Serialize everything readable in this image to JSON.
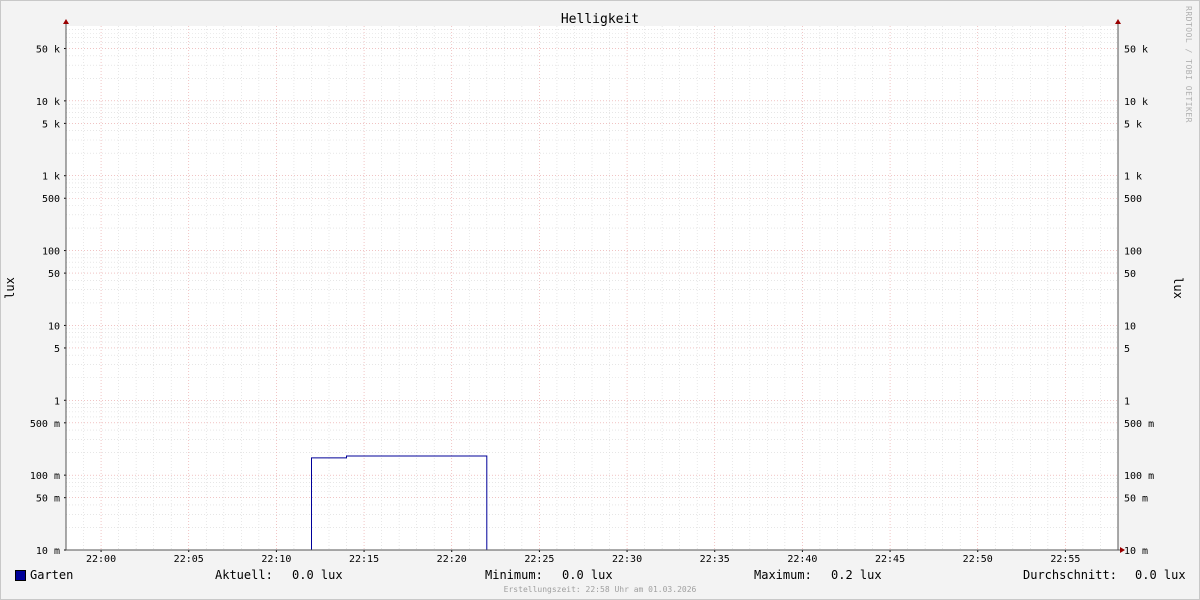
{
  "chart_data": {
    "type": "line",
    "title": "Helligkeit",
    "ylabel": "lux",
    "y_scale": "log",
    "ylim": [
      0.01,
      100000
    ],
    "y_ticks": [
      {
        "value": 0.01,
        "label": "10 m"
      },
      {
        "value": 0.05,
        "label": "50 m"
      },
      {
        "value": 0.1,
        "label": "100 m"
      },
      {
        "value": 0.5,
        "label": "500 m"
      },
      {
        "value": 1,
        "label": "1"
      },
      {
        "value": 5,
        "label": "5"
      },
      {
        "value": 10,
        "label": "10"
      },
      {
        "value": 50,
        "label": "50"
      },
      {
        "value": 100,
        "label": "100"
      },
      {
        "value": 500,
        "label": "500"
      },
      {
        "value": 1000,
        "label": "1 k"
      },
      {
        "value": 5000,
        "label": "5 k"
      },
      {
        "value": 10000,
        "label": "10 k"
      },
      {
        "value": 50000,
        "label": "50 k"
      }
    ],
    "x_ticks": [
      "22:00",
      "22:05",
      "22:10",
      "22:15",
      "22:20",
      "22:25",
      "22:30",
      "22:35",
      "22:40",
      "22:45",
      "22:50",
      "22:55"
    ],
    "xlim": [
      "21:58",
      "22:58"
    ],
    "grid": true,
    "series": [
      {
        "name": "Garten",
        "color": "#000099",
        "points": [
          [
            "21:58",
            0.01
          ],
          [
            "22:12",
            0.01
          ],
          [
            "22:12",
            0.17
          ],
          [
            "22:14",
            0.17
          ],
          [
            "22:14",
            0.18
          ],
          [
            "22:22",
            0.18
          ],
          [
            "22:22",
            0.01
          ],
          [
            "22:58",
            0.01
          ]
        ]
      }
    ]
  },
  "legend": {
    "series_name": "Garten",
    "aktuell_label": "Aktuell:",
    "aktuell_value": "0.0 lux",
    "minimum_label": "Minimum:",
    "minimum_value": "0.0 lux",
    "maximum_label": "Maximum:",
    "maximum_value": "0.2 lux",
    "durchschnitt_label": "Durchschnitt:",
    "durchschnitt_value": "0.0 lux"
  },
  "footer": "Erstellungszeit: 22:58 Uhr am 01.03.2026",
  "watermark": "RRDTOOL / TOBI OETIKER",
  "colors": {
    "background": "#f3f3f3",
    "plot": "#ffffff",
    "series": "#000099",
    "major_grid": "#e8a0a0",
    "minor_grid": "#d8d8d8",
    "arrow": "#990000"
  }
}
